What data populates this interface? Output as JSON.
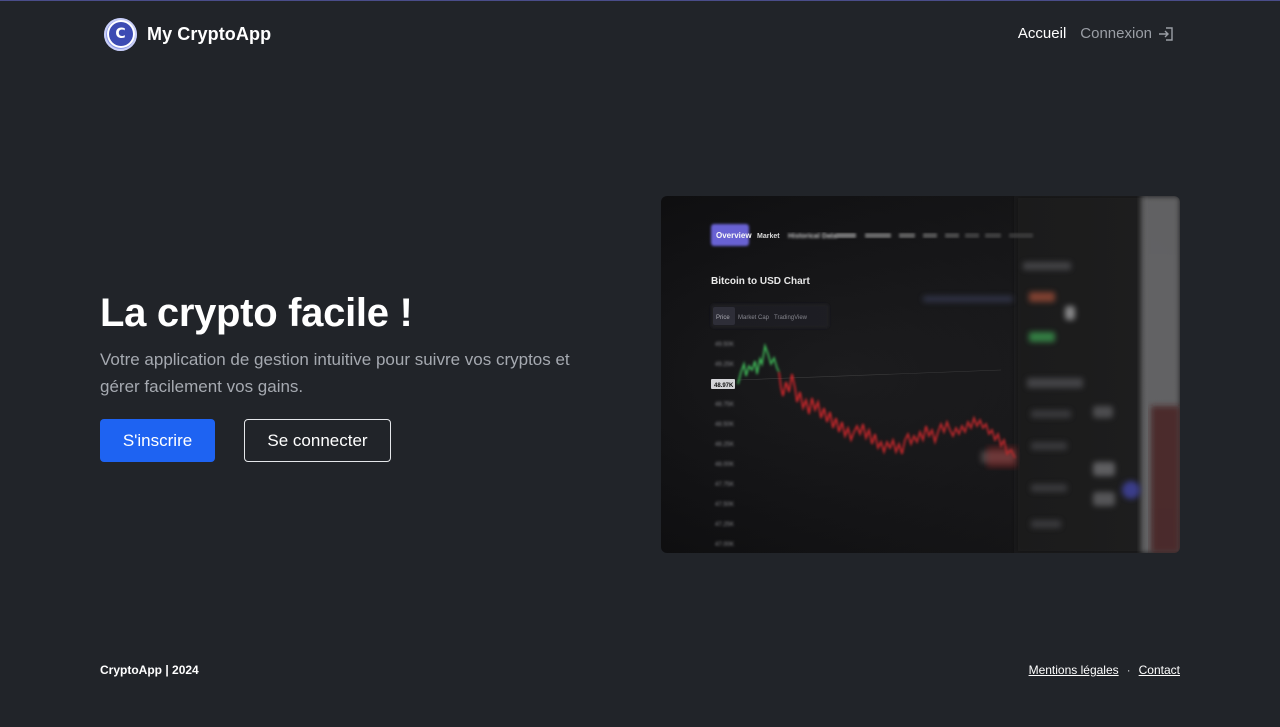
{
  "header": {
    "brand": {
      "logo_letter": "C",
      "name": "My CryptoApp"
    },
    "nav": {
      "home": "Accueil",
      "login": "Connexion",
      "login_icon": "login-icon"
    }
  },
  "hero": {
    "title": "La crypto facile !",
    "subtitle": "Votre application de gestion intuitive pour suivre vos cryptos et gérer facilement vos gains.",
    "primary_button": "S'inscrire",
    "secondary_button": "Se connecter"
  },
  "hero_image": {
    "tabs": [
      "Overview",
      "Market",
      "Historical Data"
    ],
    "chart_title": "Bitcoin to USD Chart",
    "sub_tabs": [
      "Price",
      "Market Cap",
      "TradingView"
    ],
    "y_ticks": [
      "49.50K",
      "49.25K",
      "49.00K",
      "48.75K",
      "48.50K",
      "48.25K",
      "48.00K",
      "47.75K",
      "47.50K",
      "47.25K",
      "47.00K"
    ],
    "current_price": "48.97K"
  },
  "footer": {
    "copyright": "CryptoApp | 2024",
    "links": [
      "Mentions légales",
      "Contact"
    ],
    "separator": "·"
  },
  "colors": {
    "background": "#212429",
    "primary": "#1e63f2",
    "muted_text": "#a5a9b0",
    "chart_up": "#3fbf5a",
    "chart_down": "#e0262a",
    "tab_active": "#6b63d8"
  }
}
